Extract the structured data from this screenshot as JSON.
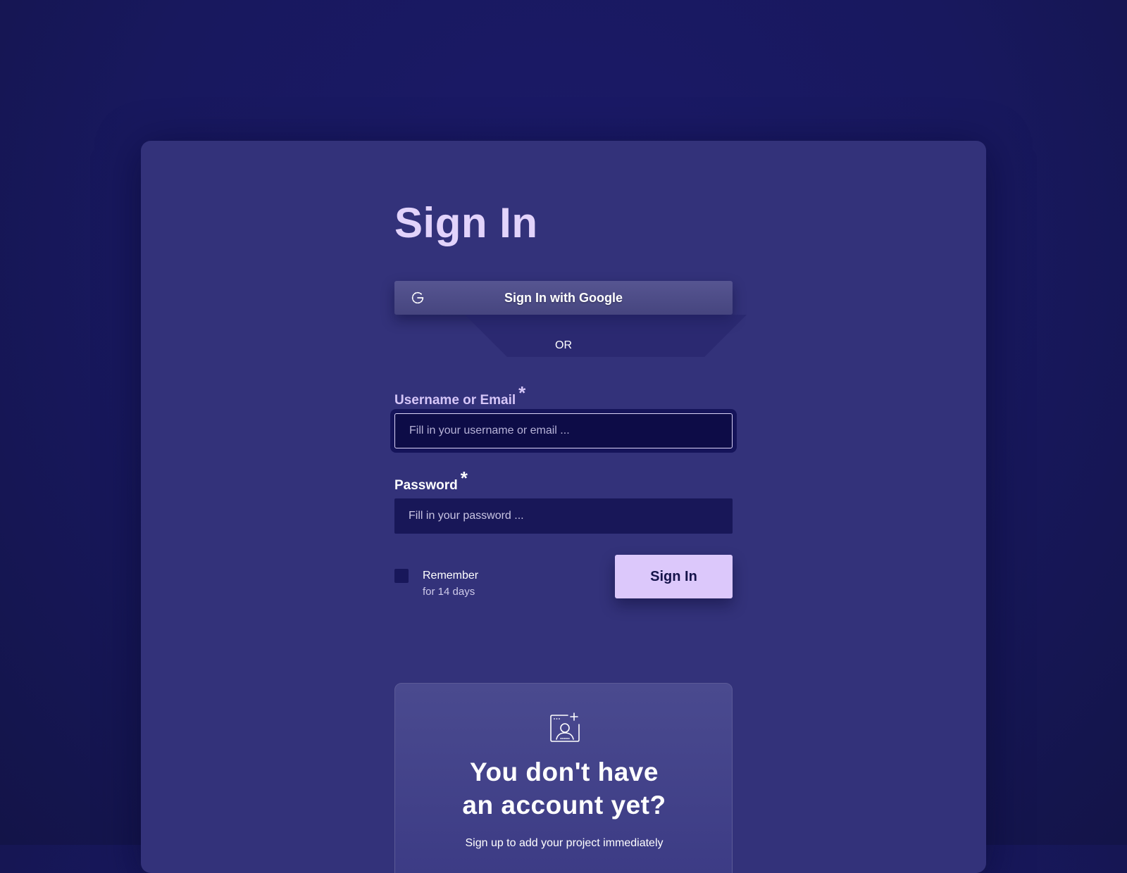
{
  "colors": {
    "background": "#18185e",
    "card": "#33327a",
    "title": "#e2d3fb",
    "primary_button": "#dcc8fb",
    "input_dark": "#0d0c47"
  },
  "page": {
    "title": "Sign In"
  },
  "google": {
    "label": "Sign In with Google",
    "icon": "google-icon"
  },
  "divider": {
    "text": "OR"
  },
  "form": {
    "username": {
      "label": "Username or Email",
      "required_mark": "*",
      "placeholder": "Fill in your username or email ...",
      "value": ""
    },
    "password": {
      "label": "Password",
      "required_mark": "*",
      "placeholder": "Fill in your password ...",
      "value": ""
    },
    "remember": {
      "label": "Remember",
      "sublabel": "for 14 days",
      "checked": false
    },
    "submit_label": "Sign In"
  },
  "signup": {
    "icon": "add-user-icon",
    "heading_line1": "You don't have",
    "heading_line2": "an account yet?",
    "subtext": "Sign up to add your project immediately"
  }
}
